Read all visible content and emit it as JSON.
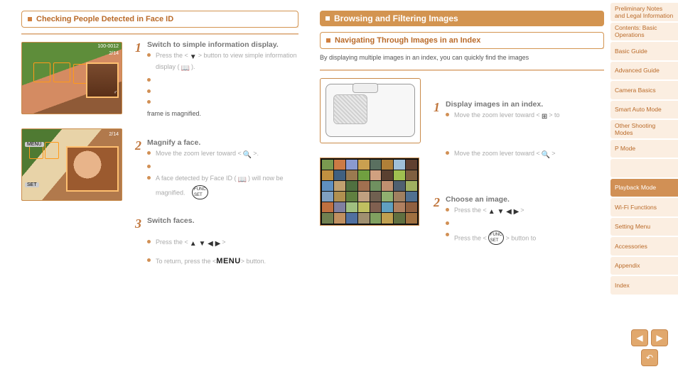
{
  "sidebar": {
    "items": [
      {
        "label": "Preliminary Notes and Legal Information"
      },
      {
        "label": "Contents: Basic Operations"
      },
      {
        "label": "Basic Guide"
      },
      {
        "label": "Advanced Guide"
      },
      {
        "label": "Camera Basics"
      },
      {
        "label": "Smart Auto Mode"
      },
      {
        "label": "Other Shooting Modes"
      },
      {
        "label": "P Mode"
      },
      {
        "label": ""
      },
      {
        "label": "Playback Mode",
        "active": true
      },
      {
        "label": "Wi-Fi Functions"
      },
      {
        "label": "Setting Menu"
      },
      {
        "label": "Accessories"
      },
      {
        "label": "Appendix"
      },
      {
        "label": "Index"
      }
    ]
  },
  "left": {
    "heading": "Checking People Detected in Face ID",
    "osd1_top": "100-0012",
    "osd1_count": "2/14",
    "osd1_gender": "♂",
    "osd2_count": "2/14",
    "osd2_menu": "MENU",
    "osd2_set": "SET",
    "steps": [
      {
        "num": "1",
        "title": "Switch to simple information display.",
        "items": [
          "Press the <▼> button to view simple information display (📖).",
          "",
          "",
          ""
        ],
        "tail": "frame is magnified."
      },
      {
        "num": "2",
        "title": "Magnify a face.",
        "items": [
          "Move the zoom lever toward <🔍>.",
          "",
          "A face detected by Face ID (📖) will now be magnified."
        ]
      },
      {
        "num": "3",
        "title": "Switch faces.",
        "items": [
          "",
          "Press the <▲><▼><◀><▶>",
          "To return, press the <"
        ],
        "menu_label": "MENU> button."
      }
    ],
    "arrows": "▲ ▼ ◀ ▶",
    "menu_word": "MENU"
  },
  "right": {
    "wide_heading": "Browsing and Filtering Images",
    "sub_heading": "Navigating Through Images in an Index",
    "lead": "By displaying multiple images in an index, you can quickly find the images",
    "steps": [
      {
        "num": "1",
        "title": "Display images in an index.",
        "items": [
          "Move the zoom lever toward <⊞> to",
          "",
          "",
          "Move the zoom lever toward <🔍>"
        ]
      },
      {
        "num": "2",
        "title": "Choose an image.",
        "items": [
          "Press the <▲><▼><◀><▶>",
          "",
          "Press the <⊕> button to"
        ]
      }
    ],
    "icon_index": "⊞",
    "icon_mag": "🔍",
    "icon_func": "⊕",
    "arrows": "▲ ▼ ◀ ▶"
  }
}
